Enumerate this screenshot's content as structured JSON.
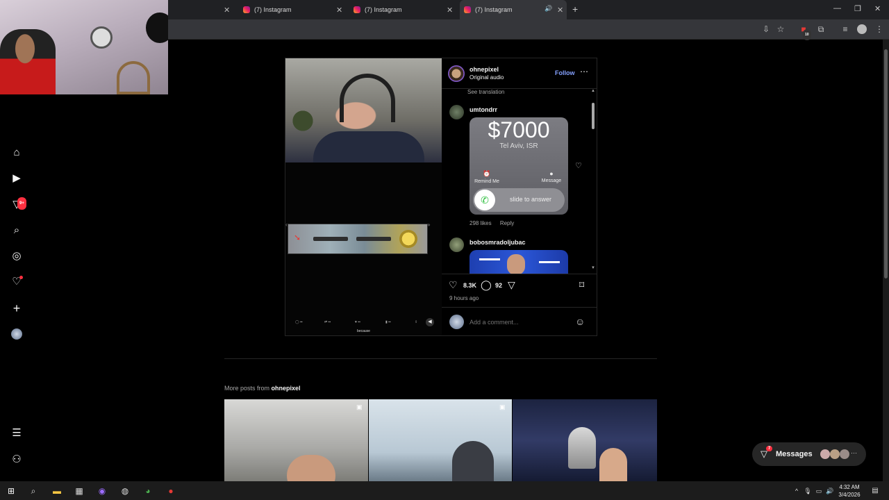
{
  "browser": {
    "tabs": [
      {
        "title": "(7) Instagram"
      },
      {
        "title": "(7) Instagram"
      },
      {
        "title": "(7) Instagram"
      }
    ],
    "new_tab": "+",
    "extension_badge": "10"
  },
  "sidebar": {
    "notifications_badge": "9+"
  },
  "post": {
    "username": "ohnepixel",
    "audio": "Original audio",
    "follow_label": "Follow",
    "see_translation": "See translation",
    "tweet_caption": "because",
    "comments": [
      {
        "username": "umtondrr",
        "call_amount": "$7000",
        "call_location": "Tel Aviv, ISR",
        "remind_label": "Remind Me",
        "message_label": "Message",
        "slide_label": "slide to answer",
        "likes": "298 likes",
        "reply": "Reply"
      },
      {
        "username": "bobosmradoljubac"
      }
    ],
    "likes_count": "8.3K",
    "comments_count": "92",
    "age": "9 hours ago",
    "comment_placeholder": "Add a comment..."
  },
  "more_posts": {
    "prefix": "More posts from",
    "username": "ohnepixel"
  },
  "messages": {
    "label": "Messages",
    "badge": "7"
  },
  "taskbar": {
    "time": "4:32 AM",
    "date": "3/4/2026"
  },
  "colors": {
    "follow_blue": "#85a1ff",
    "badge_red": "#ff3040",
    "background": "#000000"
  }
}
